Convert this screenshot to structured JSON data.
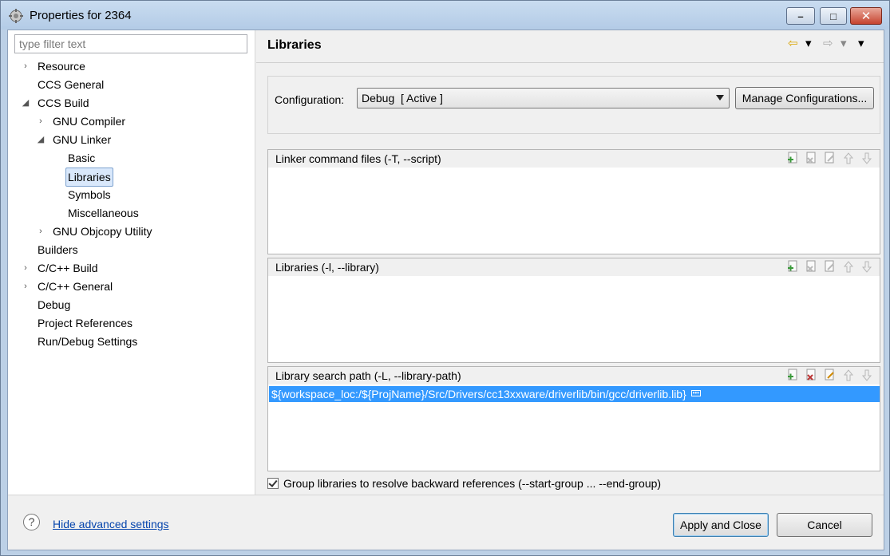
{
  "window": {
    "title": "Properties for 2364",
    "minimize_glyph": "–",
    "maximize_glyph": "□",
    "close_glyph": "✕"
  },
  "filter": {
    "placeholder": "type filter text",
    "value": ""
  },
  "tree": [
    {
      "label": "Resource",
      "twisty": "›",
      "depth": 0
    },
    {
      "label": "CCS General",
      "twisty": "",
      "depth": 0
    },
    {
      "label": "CCS Build",
      "twisty": "◢",
      "depth": 0
    },
    {
      "label": "GNU Compiler",
      "twisty": "›",
      "depth": 1
    },
    {
      "label": "GNU Linker",
      "twisty": "◢",
      "depth": 1
    },
    {
      "label": "Basic",
      "twisty": "",
      "depth": 2
    },
    {
      "label": "Libraries",
      "twisty": "",
      "depth": 2,
      "selected": true
    },
    {
      "label": "Symbols",
      "twisty": "",
      "depth": 2
    },
    {
      "label": "Miscellaneous",
      "twisty": "",
      "depth": 2
    },
    {
      "label": "GNU Objcopy Utility",
      "twisty": "›",
      "depth": 1
    },
    {
      "label": "Builders",
      "twisty": "",
      "depth": 0
    },
    {
      "label": "C/C++ Build",
      "twisty": "›",
      "depth": 0
    },
    {
      "label": "C/C++ General",
      "twisty": "›",
      "depth": 0
    },
    {
      "label": "Debug",
      "twisty": "",
      "depth": 0
    },
    {
      "label": "Project References",
      "twisty": "",
      "depth": 0
    },
    {
      "label": "Run/Debug Settings",
      "twisty": "",
      "depth": 0
    }
  ],
  "page": {
    "title": "Libraries",
    "nav": {
      "back": "⇦",
      "forward": "⇨",
      "dropdown": "▾"
    }
  },
  "configuration": {
    "label": "Configuration:",
    "value": "Debug  [ Active ]",
    "manage_label": "Manage Configurations..."
  },
  "lists": [
    {
      "title": "Linker command files (-T, --script)",
      "rows": []
    },
    {
      "title": "Libraries (-l, --library)",
      "rows": []
    },
    {
      "title": "Library search path (-L, --library-path)",
      "rows": [
        "${workspace_loc:/${ProjName}/Src/Drivers/cc13xxware/driverlib/bin/gcc/driverlib.lib}"
      ]
    }
  ],
  "group_option": {
    "label": "Group libraries to resolve backward references (--start-group ... --end-group)",
    "checked": true
  },
  "footer": {
    "help_glyph": "?",
    "advanced_link": "Hide advanced settings",
    "apply_label": "Apply and Close",
    "cancel_label": "Cancel"
  },
  "colors": {
    "selection": "#3399ff",
    "link": "#0645ad",
    "tree_selected": "#d9e8fb"
  }
}
